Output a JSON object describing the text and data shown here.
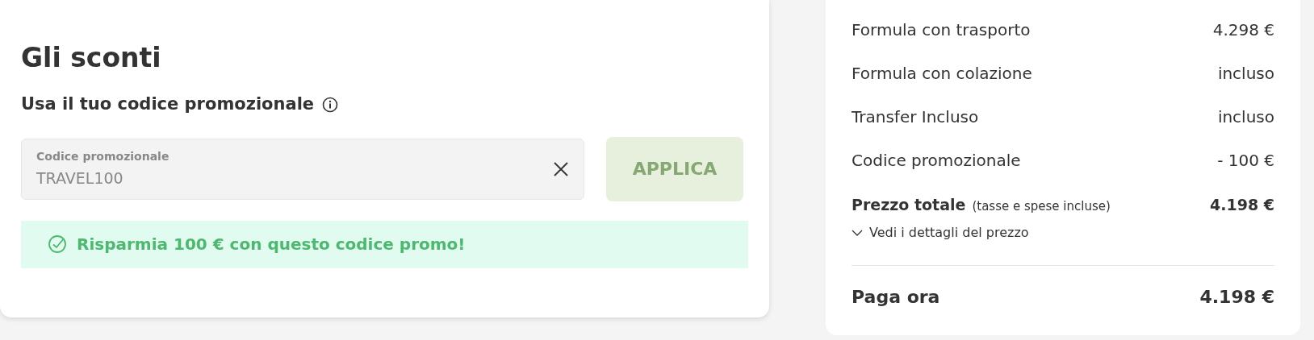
{
  "discounts": {
    "title": "Gli sconti",
    "subtitle": "Usa il tuo codice promozionale",
    "promo_field": {
      "label": "Codice promozionale",
      "value": "TRAVEL100"
    },
    "apply_button": {
      "label": "APPLICA",
      "disabled": true
    },
    "message": "Risparmia 100 € con questo codice promo!"
  },
  "summary": {
    "rows": [
      {
        "label": "Formula con trasporto",
        "value": "4.298 €"
      },
      {
        "label": "Formula con colazione",
        "value": "incluso"
      },
      {
        "label": "Transfer Incluso",
        "value": "incluso"
      },
      {
        "label": "Codice promozionale",
        "value": "- 100 €"
      }
    ],
    "total": {
      "label": "Prezzo totale",
      "note": "(tasse e spese incluse)",
      "value": "4.198 €"
    },
    "details_link": "Vedi i dettagli del prezzo",
    "pay_now": {
      "label": "Paga ora",
      "value": "4.198 €"
    }
  }
}
